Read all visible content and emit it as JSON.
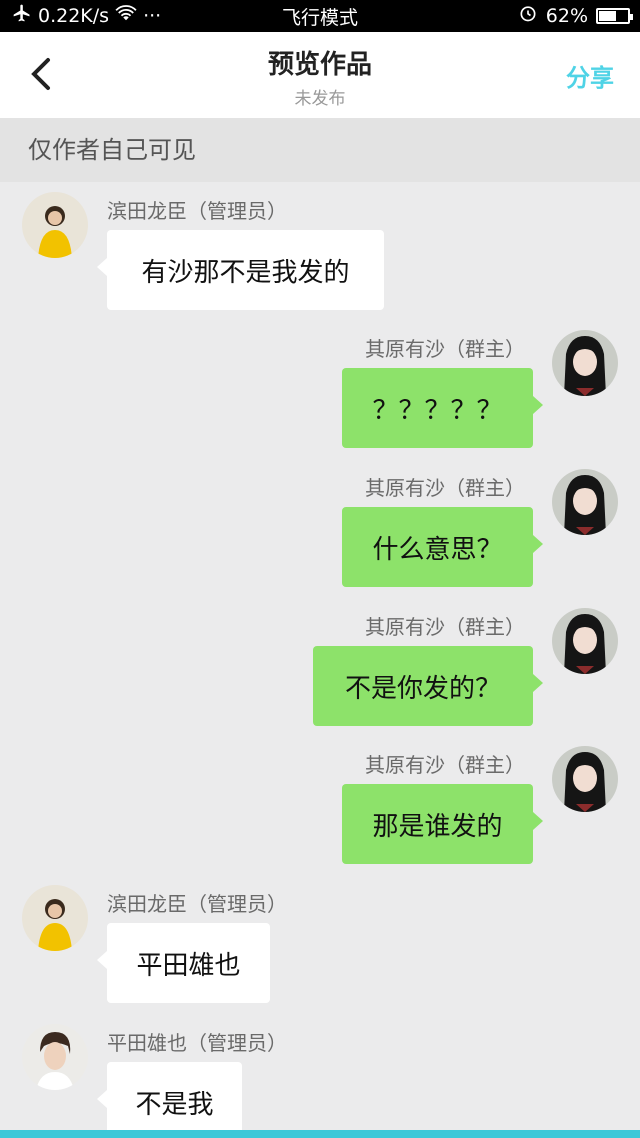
{
  "status_bar": {
    "speed": "0.22K/s",
    "dots": "···",
    "mode": "飞行模式",
    "battery": "62%",
    "battery_level": 0.62
  },
  "header": {
    "title": "预览作品",
    "subtitle": "未发布",
    "share": "分享"
  },
  "notice": "仅作者自己可见",
  "messages": [
    {
      "side": "left",
      "sender": "滨田龙臣（管理员）",
      "text": "有沙那不是我发的",
      "avatar": "yellow-hoodie-avatar"
    },
    {
      "side": "right",
      "sender": "其原有沙（群主）",
      "text": "？？？？？",
      "avatar": "girl-black-hair-avatar"
    },
    {
      "side": "right",
      "sender": "其原有沙（群主）",
      "text": "什么意思？",
      "avatar": "girl-black-hair-avatar"
    },
    {
      "side": "right",
      "sender": "其原有沙（群主）",
      "text": "不是你发的？",
      "avatar": "girl-black-hair-avatar"
    },
    {
      "side": "right",
      "sender": "其原有沙（群主）",
      "text": "那是谁发的",
      "avatar": "girl-black-hair-avatar"
    },
    {
      "side": "left",
      "sender": "滨田龙臣（管理员）",
      "text": "平田雄也",
      "avatar": "yellow-hoodie-avatar"
    },
    {
      "side": "left",
      "sender": "平田雄也（管理员）",
      "text": "不是我",
      "avatar": "boy-white-shirt-avatar"
    }
  ],
  "colors": {
    "accent": "#4fd3e6",
    "right_bubble": "#8de26a",
    "left_bubble": "#ffffff",
    "background": "#ebebec",
    "bottom_bar": "#3cc8d8"
  }
}
